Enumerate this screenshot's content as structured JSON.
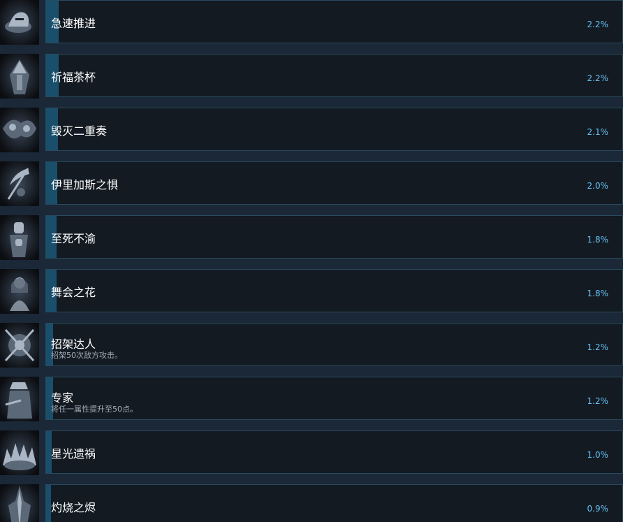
{
  "achievements": [
    {
      "title": "急速推进",
      "description": "",
      "percent": "2.2%",
      "percent_value": 2.2,
      "icon": "rider-helmet-icon"
    },
    {
      "title": "祈福茶杯",
      "description": "",
      "percent": "2.2%",
      "percent_value": 2.2,
      "icon": "hooded-witch-icon"
    },
    {
      "title": "毁灭二重奏",
      "description": "",
      "percent": "2.1%",
      "percent_value": 2.1,
      "icon": "twin-beast-icon"
    },
    {
      "title": "伊里加斯之惧",
      "description": "",
      "percent": "2.0%",
      "percent_value": 2.0,
      "icon": "scythe-icon"
    },
    {
      "title": "至死不渝",
      "description": "",
      "percent": "1.8%",
      "percent_value": 1.8,
      "icon": "knight-hands-icon"
    },
    {
      "title": "舞会之花",
      "description": "",
      "percent": "1.8%",
      "percent_value": 1.8,
      "icon": "lady-portrait-icon"
    },
    {
      "title": "招架达人",
      "description": "招架50次敌方攻击。",
      "percent": "1.2%",
      "percent_value": 1.2,
      "icon": "crossed-swords-emblem-icon"
    },
    {
      "title": "专家",
      "description": "将任一属性提升至50点。",
      "percent": "1.2%",
      "percent_value": 1.2,
      "icon": "hunter-icon"
    },
    {
      "title": "星光遗祸",
      "description": "",
      "percent": "1.0%",
      "percent_value": 1.0,
      "icon": "spiked-beast-icon"
    },
    {
      "title": "灼烧之烬",
      "description": "",
      "percent": "0.9%",
      "percent_value": 0.9,
      "icon": "gothic-spire-icon"
    }
  ],
  "colors": {
    "background": "#1b2838",
    "panel": "#131a22",
    "panel_border": "#2a4a5d",
    "progress": "#1a4f6c",
    "percent_text": "#66c0f4"
  }
}
